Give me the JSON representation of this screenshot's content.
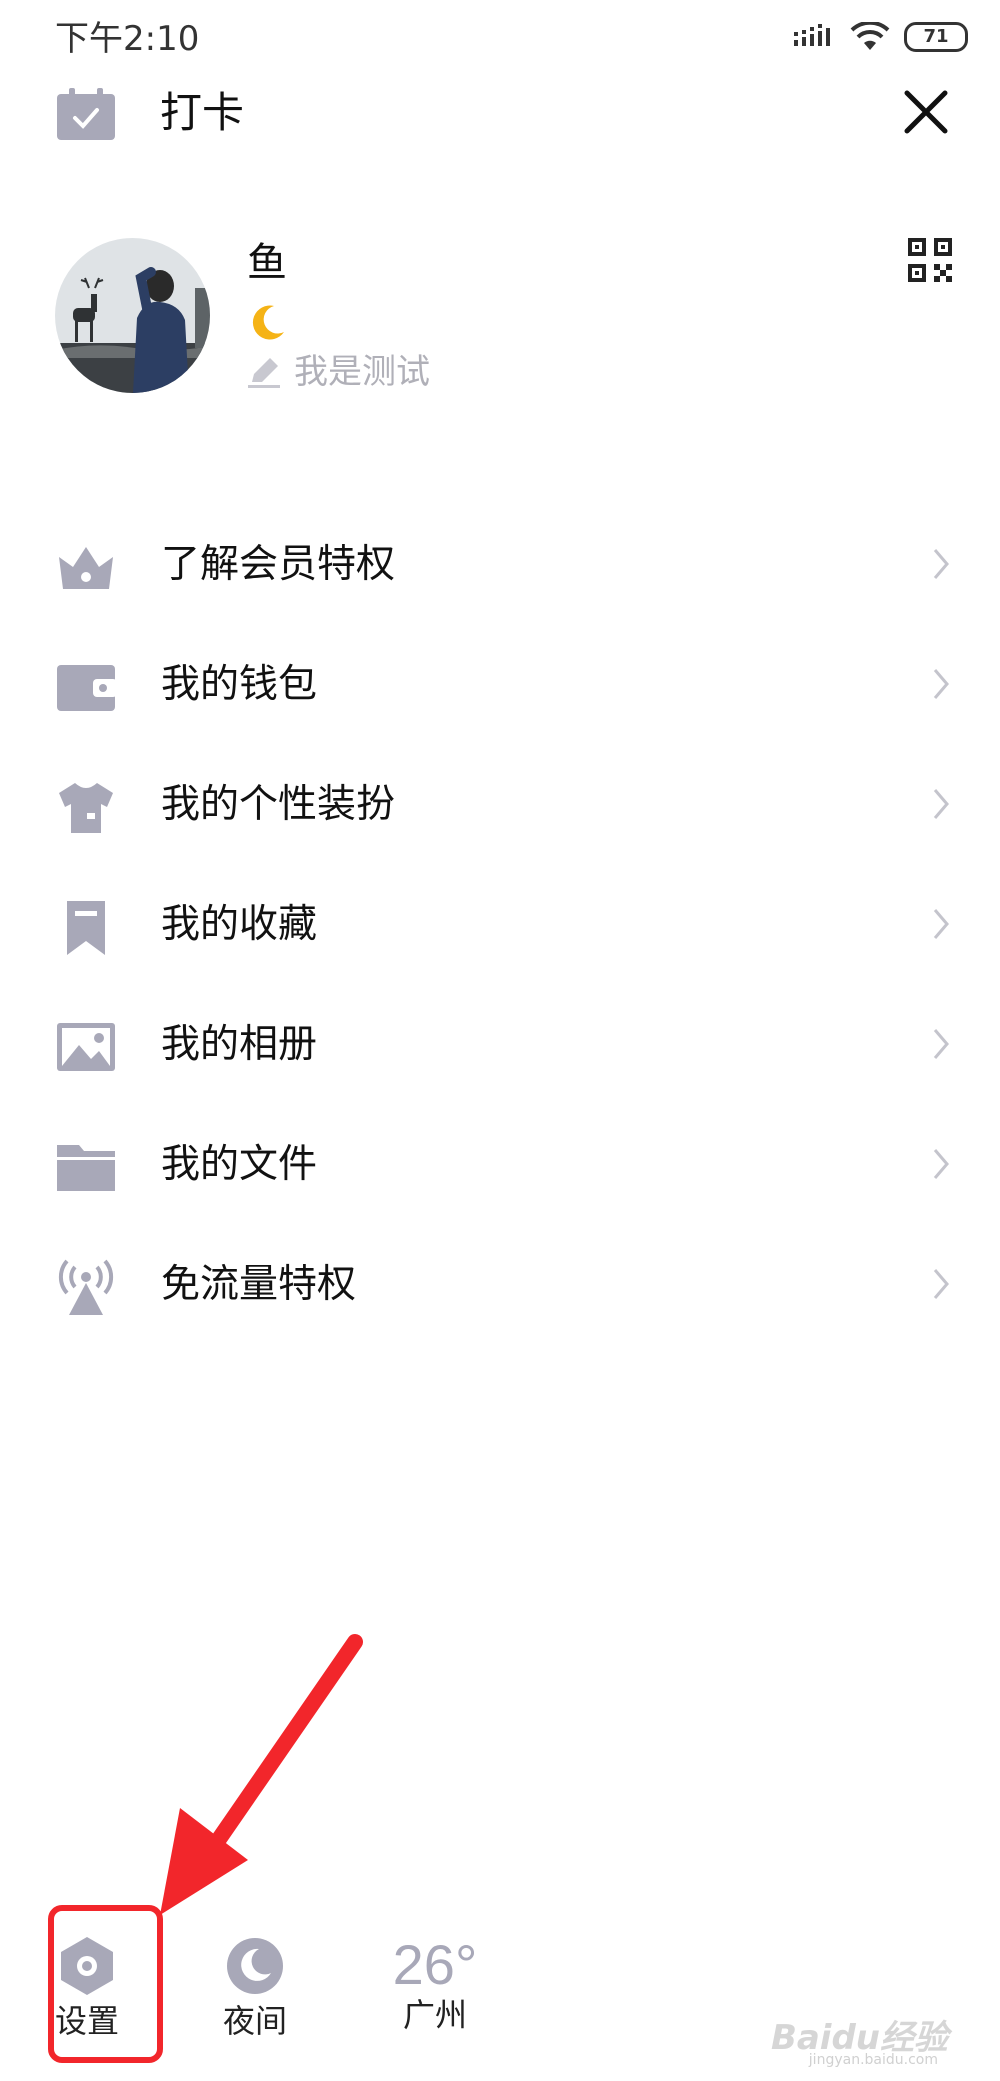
{
  "status_bar": {
    "time": "下午2:10",
    "battery": "71"
  },
  "header": {
    "checkin_label": "打卡",
    "close_icon": "close-icon"
  },
  "profile": {
    "name": "鱼",
    "status_emoji": "🌙",
    "signature": "我是测试"
  },
  "menu": {
    "items": [
      {
        "label": "了解会员特权",
        "icon": "crown-icon"
      },
      {
        "label": "我的钱包",
        "icon": "wallet-icon"
      },
      {
        "label": "我的个性装扮",
        "icon": "tshirt-icon"
      },
      {
        "label": "我的收藏",
        "icon": "bookmark-icon"
      },
      {
        "label": "我的相册",
        "icon": "image-icon"
      },
      {
        "label": "我的文件",
        "icon": "folder-icon"
      },
      {
        "label": "免流量特权",
        "icon": "signal-tower-icon"
      }
    ]
  },
  "bottom_bar": {
    "settings_label": "设置",
    "night_label": "夜间",
    "weather_temp": "26°",
    "weather_city": "广州"
  },
  "annotation": {
    "highlight_color": "#f2262b"
  },
  "watermark": {
    "text": "Baidu经验",
    "sub": "jingyan.baidu.com"
  }
}
